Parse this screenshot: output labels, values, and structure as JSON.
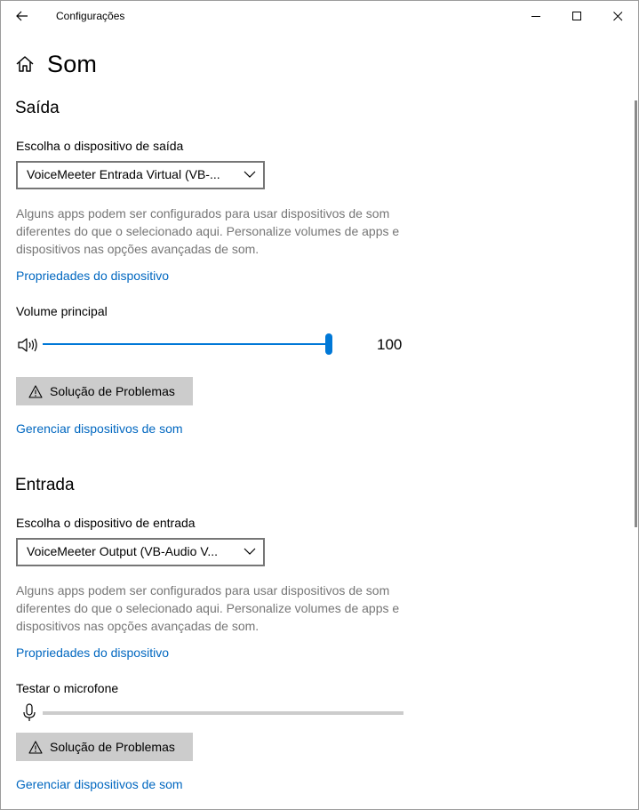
{
  "window": {
    "title": "Configurações",
    "controls": [
      "minimize",
      "maximize",
      "close"
    ]
  },
  "header": {
    "title": "Som",
    "icon": "home-icon"
  },
  "output": {
    "section_title": "Saída",
    "device_label": "Escolha o dispositivo de saída",
    "device_value": "VoiceMeeter Entrada Virtual (VB-...",
    "description": "Alguns apps podem ser configurados para usar dispositivos de som diferentes do que o selecionado aqui. Personalize volumes de apps e dispositivos nas opções avançadas de som.",
    "properties_link": "Propriedades do dispositivo",
    "volume_label": "Volume principal",
    "volume_value": "100",
    "volume_level_percent": 100,
    "troubleshoot_label": "Solução de Problemas",
    "manage_link": "Gerenciar dispositivos de som"
  },
  "input": {
    "section_title": "Entrada",
    "device_label": "Escolha o dispositivo de entrada",
    "device_value": "VoiceMeeter Output (VB-Audio V...",
    "description": "Alguns apps podem ser configurados para usar dispositivos de som diferentes do que o selecionado aqui. Personalize volumes de apps e dispositivos nas opções avançadas de som.",
    "properties_link": "Propriedades do dispositivo",
    "mic_test_label": "Testar o microfone",
    "mic_level_percent": 0,
    "troubleshoot_label": "Solução de Problemas",
    "manage_link": "Gerenciar dispositivos de som"
  },
  "colors": {
    "accent": "#0078d7",
    "link": "#0067c0",
    "secondary_text": "#767676",
    "button_bg": "#cccccc"
  }
}
